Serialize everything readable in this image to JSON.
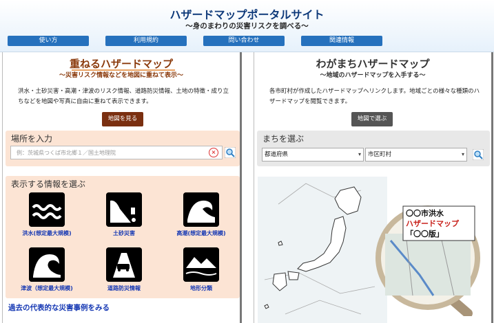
{
  "header": {
    "title": "ハザードマップポータルサイト",
    "subtitle": "～身のまわりの災害リスクを調べる～",
    "nav": [
      "使い方",
      "利用規約",
      "問い合わせ",
      "関連情報"
    ]
  },
  "left_panel": {
    "title": "重ねるハザードマップ",
    "subtitle": "～災害リスク情報などを地図に重ねて表示～",
    "description": "洪水・土砂災害・高潮・津波のリスク情報、道路防災情報、土地の特徴・成り立ちなどを地図や写真に自由に重ねて表示できます。",
    "button_label": "地図を見る",
    "search": {
      "label": "場所を入力",
      "placeholder": "例：茨城県つくば市北郷１／国土地理院"
    },
    "info_section": {
      "label": "表示する情報を選ぶ",
      "items": [
        {
          "label": "洪水(想定最大規模)",
          "icon": "flood-icon"
        },
        {
          "label": "土砂災害",
          "icon": "landslide-icon"
        },
        {
          "label": "高潮(想定最大規模)",
          "icon": "storm-surge-icon"
        },
        {
          "label": "津波（想定最大規模)",
          "icon": "tsunami-icon"
        },
        {
          "label": "道路防災情報",
          "icon": "road-disaster-icon"
        },
        {
          "label": "地形分類",
          "icon": "landform-icon"
        }
      ]
    },
    "bottom_link": "過去の代表的な災害事例をみる"
  },
  "right_panel": {
    "title": "わがまちハザードマップ",
    "subtitle": "～地域のハザードマップを入手する～",
    "description": "各市町村が作成したハザードマップへリンクします。地域ごとの様々な種類のハザードマップを閲覧できます。",
    "button_label": "地図で選ぶ",
    "select_section": {
      "label": "まちを選ぶ",
      "prefecture": "都道府県",
      "city": "市区町村"
    },
    "magnifier": {
      "line1": "〇〇市洪水",
      "line2": "ハザードマップ",
      "line3": "「〇〇版」"
    }
  },
  "colors": {
    "nav_blue": "#2671bd",
    "left_accent": "#8a3a0c",
    "left_box": "#fce4d4",
    "right_box": "#e8e8e8",
    "link_blue": "#1437b3"
  }
}
